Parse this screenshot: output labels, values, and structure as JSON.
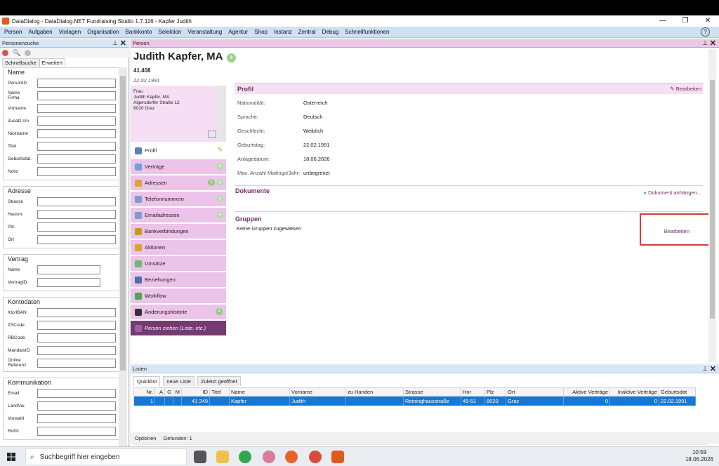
{
  "window": {
    "title": "DataDialog - DataDialog.NET Fundraising Studio 1.7.116 - Kapfer Judith"
  },
  "menu": [
    "Person",
    "Aufgaben",
    "Vorlagen",
    "Organisation",
    "Bankkonto",
    "Selektion",
    "Veranstaltung",
    "Agentur",
    "Shop",
    "Instanz",
    "Zentral",
    "Debug",
    "Schnellfunktionen"
  ],
  "left": {
    "title": "Personensuche",
    "tabs": [
      "Schnellsuche",
      "Erweitert"
    ],
    "groups": [
      {
        "title": "Name",
        "fields": [
          "PersonID",
          "Name\nFirma",
          "Vorname",
          "Zusatz c/o",
          "Nickname",
          "Titel",
          "Geburtsdat.",
          "Notiz"
        ]
      },
      {
        "title": "Adresse",
        "fields": [
          "Strasse",
          "Hausnr.",
          "Plz.",
          "Ort"
        ]
      },
      {
        "title": "Vertrag",
        "fields": [
          "Name",
          "VertragID"
        ]
      },
      {
        "title": "Kontodaten",
        "fields": [
          "Kto/IBAN",
          "ZSCode",
          "RBCode",
          "MandatsID",
          "Online\nReferenz:"
        ]
      },
      {
        "title": "Kommunikation",
        "fields": [
          "Email",
          "LandVw.",
          "Vorwahl",
          "Rufnr."
        ]
      }
    ]
  },
  "person": {
    "panel": "Person",
    "name": "Judith Kapfer, MA",
    "id": "41.408",
    "birth": "22.02.1991",
    "address": [
      "Frau",
      "Judith Kapfer, MA",
      "Algersdorfer Straße 12",
      "8020 Graz"
    ],
    "nav": [
      {
        "label": "Profil"
      },
      {
        "label": "Verträge"
      },
      {
        "label": "Adressen",
        "count": "1"
      },
      {
        "label": "Telefonnummern"
      },
      {
        "label": "Emailadressen"
      },
      {
        "label": "Bankverbindungen"
      },
      {
        "label": "Aktionen"
      },
      {
        "label": "Umsätze"
      },
      {
        "label": "Beziehungen"
      },
      {
        "label": "Workflow"
      },
      {
        "label": "Änderungshistorie",
        "count": "4"
      },
      {
        "label": "Person ziehen (Liste, etc.)"
      }
    ],
    "profil": {
      "title": "Profil",
      "edit": "Bearbeiten",
      "rows": [
        [
          "Nationalität:",
          "Österreich"
        ],
        [
          "Sprache:",
          "Deutsch"
        ],
        [
          "Geschlecht:",
          "Weiblich"
        ],
        [
          "Geburtstag:",
          "22.02.1991"
        ],
        [
          "Anlagedatum:",
          "18.06.2026"
        ],
        [
          "Max. Anzahl Mailings/Jahr:",
          "unbegrenzt"
        ]
      ]
    },
    "dokumente": {
      "title": "Dokumente",
      "action": "Dokument anhängen..."
    },
    "gruppen": {
      "title": "Gruppen",
      "empty": "Keine Gruppen zugewiesen",
      "edit": "Bearbeiten"
    }
  },
  "lists": {
    "title": "Listen",
    "tabs": [
      "Quicklist",
      "neue Liste",
      "Zuletzt geöffnet"
    ],
    "columns": [
      "Nr.",
      "A",
      "G",
      "M",
      "ID",
      "Titel",
      "Name",
      "Vorname",
      "zu Handen",
      "Strasse",
      "Hnr",
      "Plz",
      "Ort",
      "Aktive Verträge",
      "Inaktive Verträge",
      "Geburtsdat"
    ],
    "row": [
      "1",
      "",
      "",
      "",
      "41 249",
      "",
      "Kapfer",
      "Judith",
      "",
      "Reininghausstraße",
      "49-51",
      "8020",
      "Graz",
      "0",
      "0",
      "22.02.1991"
    ],
    "footer": {
      "options": "Optionen",
      "found": "Gefunden: 1"
    }
  },
  "taskbar": {
    "search": "Suchbegriff hier eingeben",
    "time": "10:59",
    "date": "18.06.2026"
  }
}
